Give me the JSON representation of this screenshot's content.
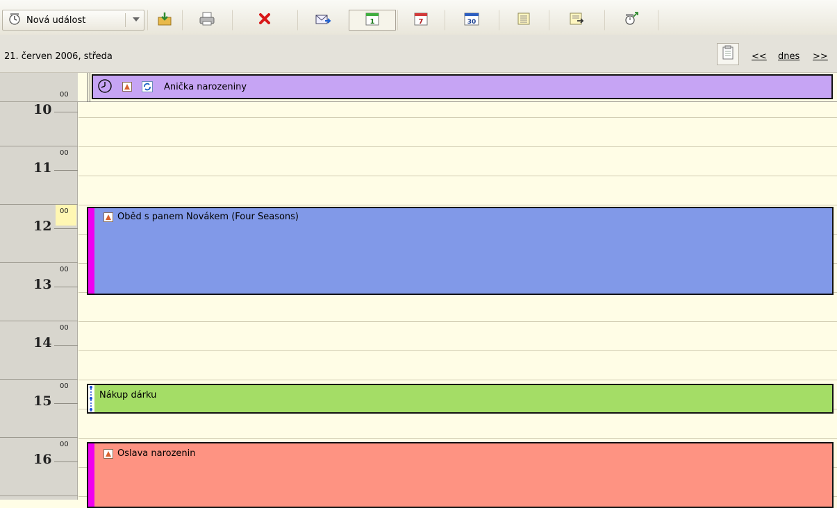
{
  "toolbar": {
    "new_event_label": "Nová událost",
    "buttons": [
      {
        "name": "import-icon"
      },
      {
        "name": "print-icon"
      },
      {
        "name": "delete-icon"
      },
      {
        "name": "send-icon"
      },
      {
        "name": "day-view-icon",
        "label": "1"
      },
      {
        "name": "week-view-icon",
        "label": "7"
      },
      {
        "name": "month-view-icon",
        "label": "30"
      },
      {
        "name": "list-view-icon"
      },
      {
        "name": "task-list-icon"
      },
      {
        "name": "reminder-icon"
      }
    ]
  },
  "datebar": {
    "date": "21. červen 2006, středa",
    "prev": "<<",
    "today": "dnes",
    "next": ">>"
  },
  "hours": [
    {
      "h": "10",
      "m": "00"
    },
    {
      "h": "11",
      "m": "00"
    },
    {
      "h": "12",
      "m": "00"
    },
    {
      "h": "13",
      "m": "00"
    },
    {
      "h": "14",
      "m": "00"
    },
    {
      "h": "15",
      "m": "00"
    },
    {
      "h": "16",
      "m": "00"
    }
  ],
  "events": {
    "allday": {
      "title": "Anička narozeniny",
      "color": "#c6a4f4"
    },
    "lunch": {
      "title": "Oběd s panem Novákem (Four Seasons)",
      "color": "#8199e8"
    },
    "gift": {
      "title": "Nákup dárku",
      "color": "#a4dd66"
    },
    "party": {
      "title": "Oslava narozenin",
      "color": "#fe9382"
    }
  },
  "colors": {
    "grid_bg": "#fffde6",
    "time_bg": "#d8d6ce",
    "busy_bar": "#f000f0"
  }
}
